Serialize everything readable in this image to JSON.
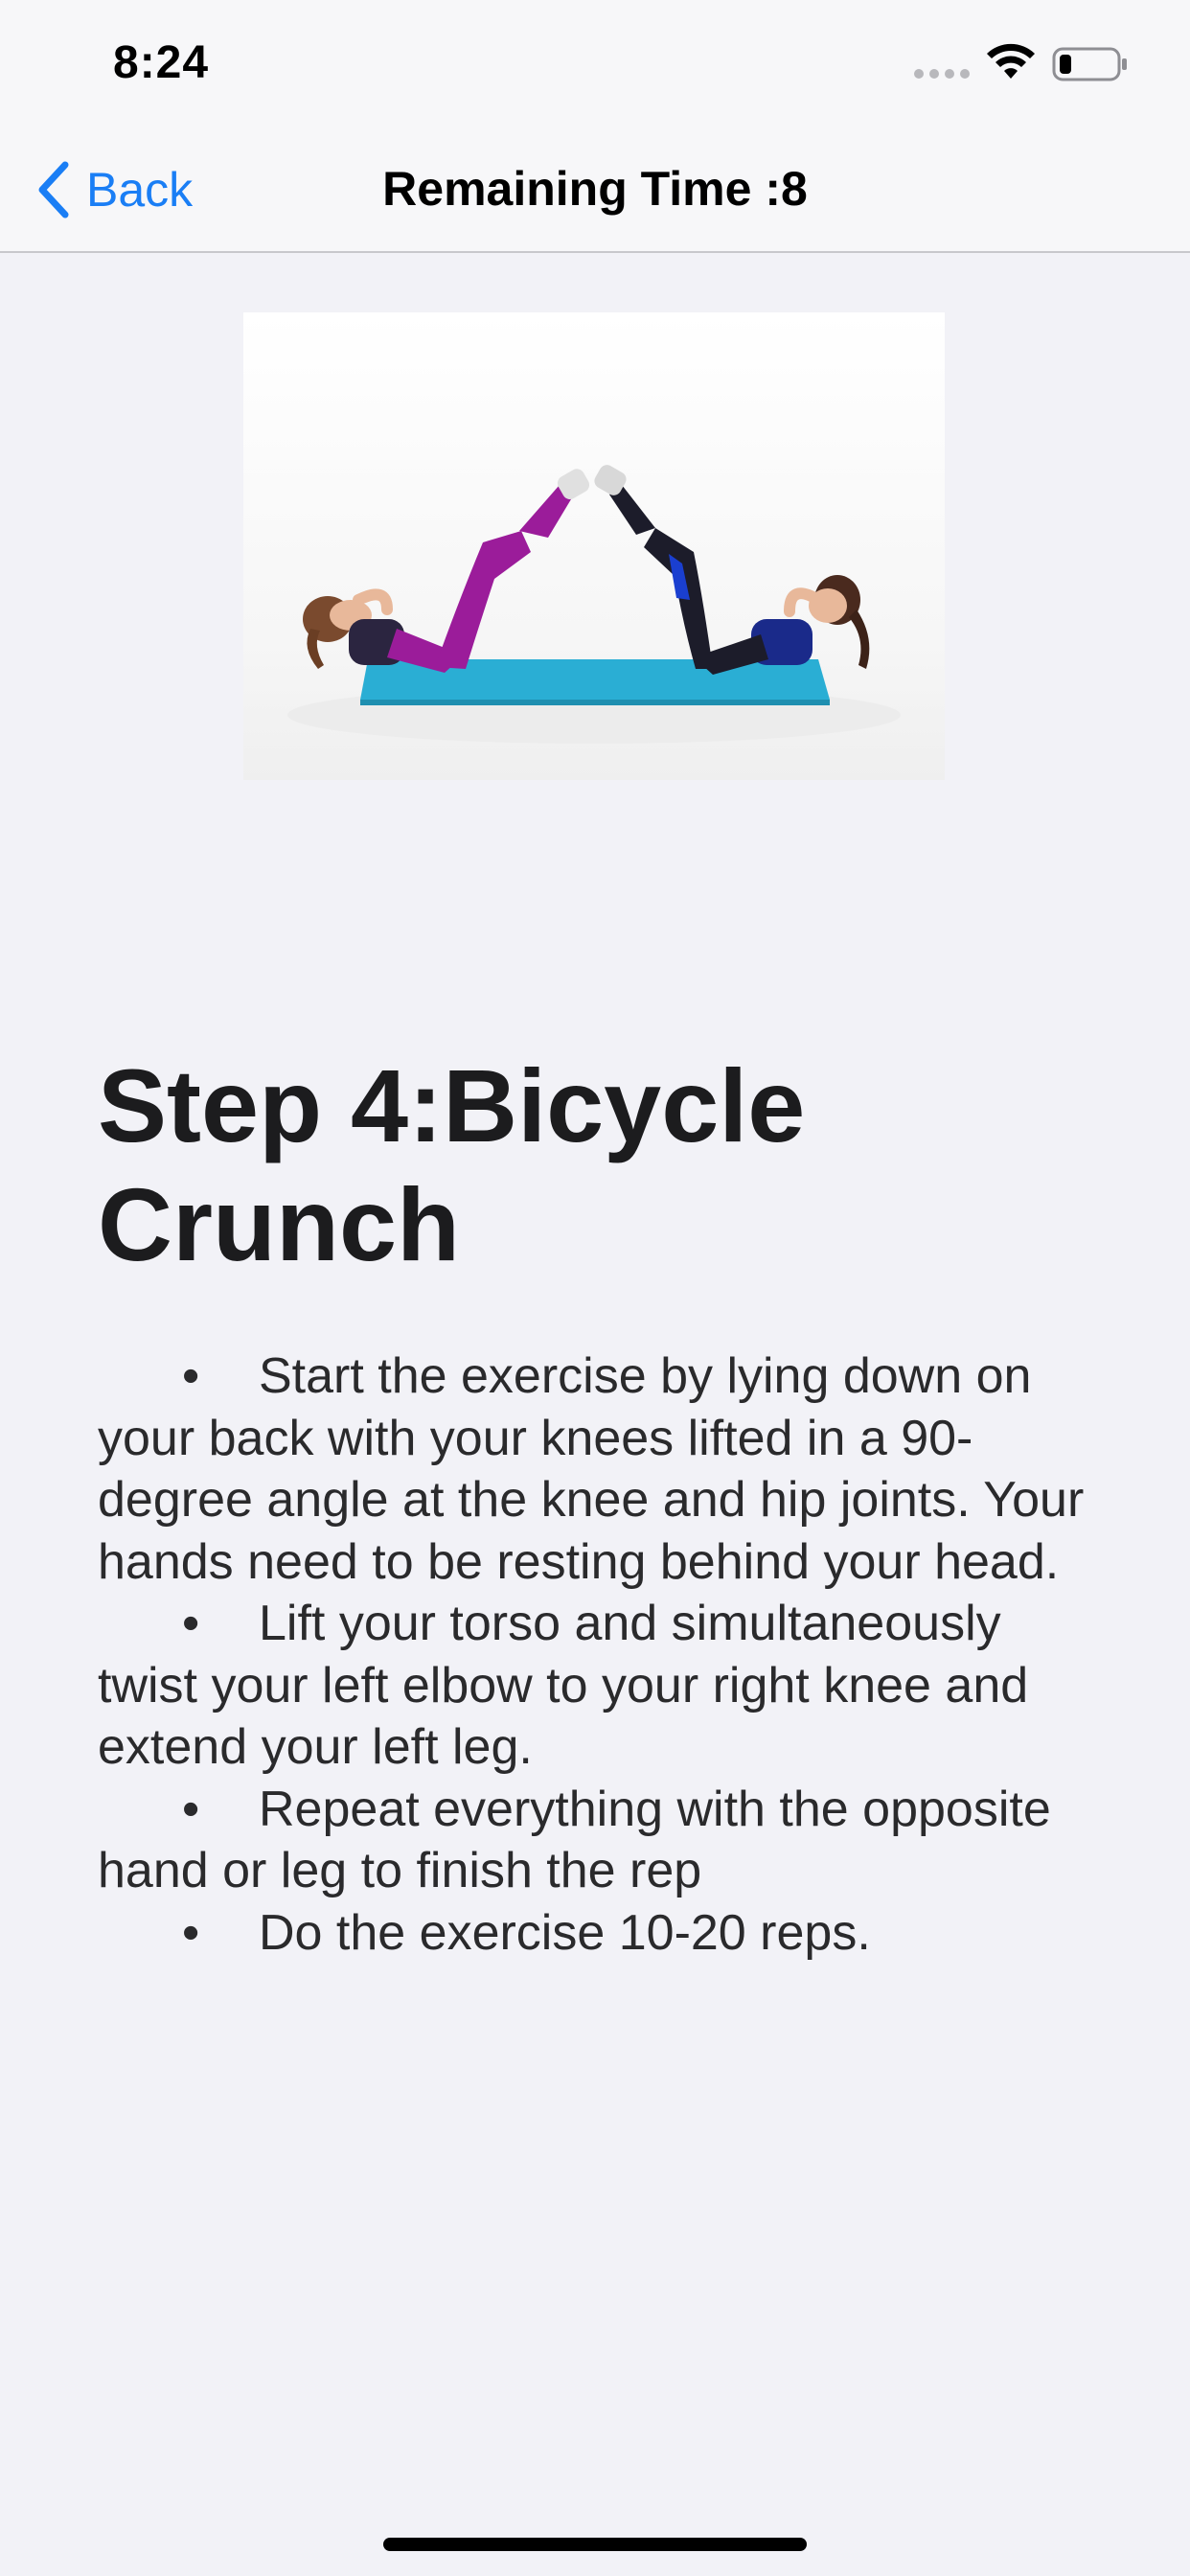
{
  "status_bar": {
    "time": "8:24",
    "icons": [
      "signal-dots-icon",
      "wifi-icon",
      "battery-icon"
    ]
  },
  "nav": {
    "back_label": "Back",
    "title": "Remaining Time :8"
  },
  "exercise": {
    "image_icon": "exercise-photo",
    "step_title": "Step 4:Bicycle Crunch",
    "instructions": [
      {
        "bullet": "•",
        "text": "Start the exercise by lying down on your back with your knees lifted in a 90-degree angle at the knee and hip joints. Your hands need to be resting behind your head."
      },
      {
        "bullet": "•",
        "text": "Lift your torso and simultaneously twist your left elbow to your right knee and extend your left leg."
      },
      {
        "bullet": "•",
        "text": "Repeat everything with the opposite hand or leg to finish the rep"
      },
      {
        "bullet": "•",
        "text": "Do the exercise 10-20 reps."
      }
    ]
  },
  "colors": {
    "background": "#f2f2f7",
    "accent": "#1a7ef5",
    "text": "#1c1c1e",
    "mat": "#2aaed4",
    "leggings_left": "#9b1c9a",
    "leggings_right": "#1c1c2a"
  }
}
